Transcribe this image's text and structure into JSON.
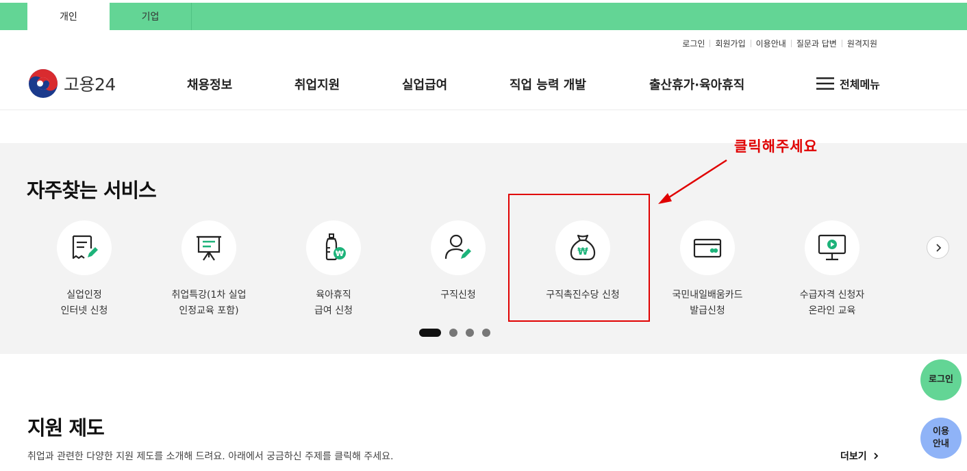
{
  "top_tabs": [
    "개인",
    "기업"
  ],
  "util_links": [
    "로그인",
    "회원가입",
    "이용안내",
    "질문과 답변",
    "원격지원"
  ],
  "logo": {
    "text": "고용24"
  },
  "gnb": [
    "채용정보",
    "취업지원",
    "실업급여",
    "직업 능력 개발",
    "출산휴가·육아휴직"
  ],
  "all_menu": "전체메뉴",
  "frequent": {
    "title": "자주찾는 서비스",
    "items": [
      {
        "line1": "실업인정",
        "line2": "인터넷 신청",
        "icon": "document-pen-icon"
      },
      {
        "line1": "취업특강(1차 실업",
        "line2": "인정교육 포함)",
        "icon": "presentation-board-icon"
      },
      {
        "line1": "육아휴직",
        "line2": "급여 신청",
        "icon": "baby-bottle-won-icon"
      },
      {
        "line1": "구직신청",
        "line2": "",
        "icon": "person-pen-icon"
      },
      {
        "line1": "구직촉진수당 신청",
        "line2": "",
        "icon": "money-bag-won-icon"
      },
      {
        "line1": "국민내일배움카드",
        "line2": "발급신청",
        "icon": "card-icon"
      },
      {
        "line1": "수급자격 신청자",
        "line2": "온라인 교육",
        "icon": "monitor-play-icon"
      }
    ],
    "page_count": 4,
    "active_page": 1
  },
  "annotation": {
    "text": "클릭해주세요",
    "color": "#e00000"
  },
  "support": {
    "title": "지원 제도",
    "desc": "취업과 관련한 다양한 지원 제도를 소개해 드려요. 아래에서 궁금하신 주제를 클릭해 주세요.",
    "more": "더보기"
  },
  "floating": {
    "login": "로그인",
    "guide_line1": "이용",
    "guide_line2": "안내"
  },
  "colors": {
    "brand_green": "#63d595",
    "accent_green": "#1db37a",
    "guide_blue": "#8fb3f7"
  }
}
